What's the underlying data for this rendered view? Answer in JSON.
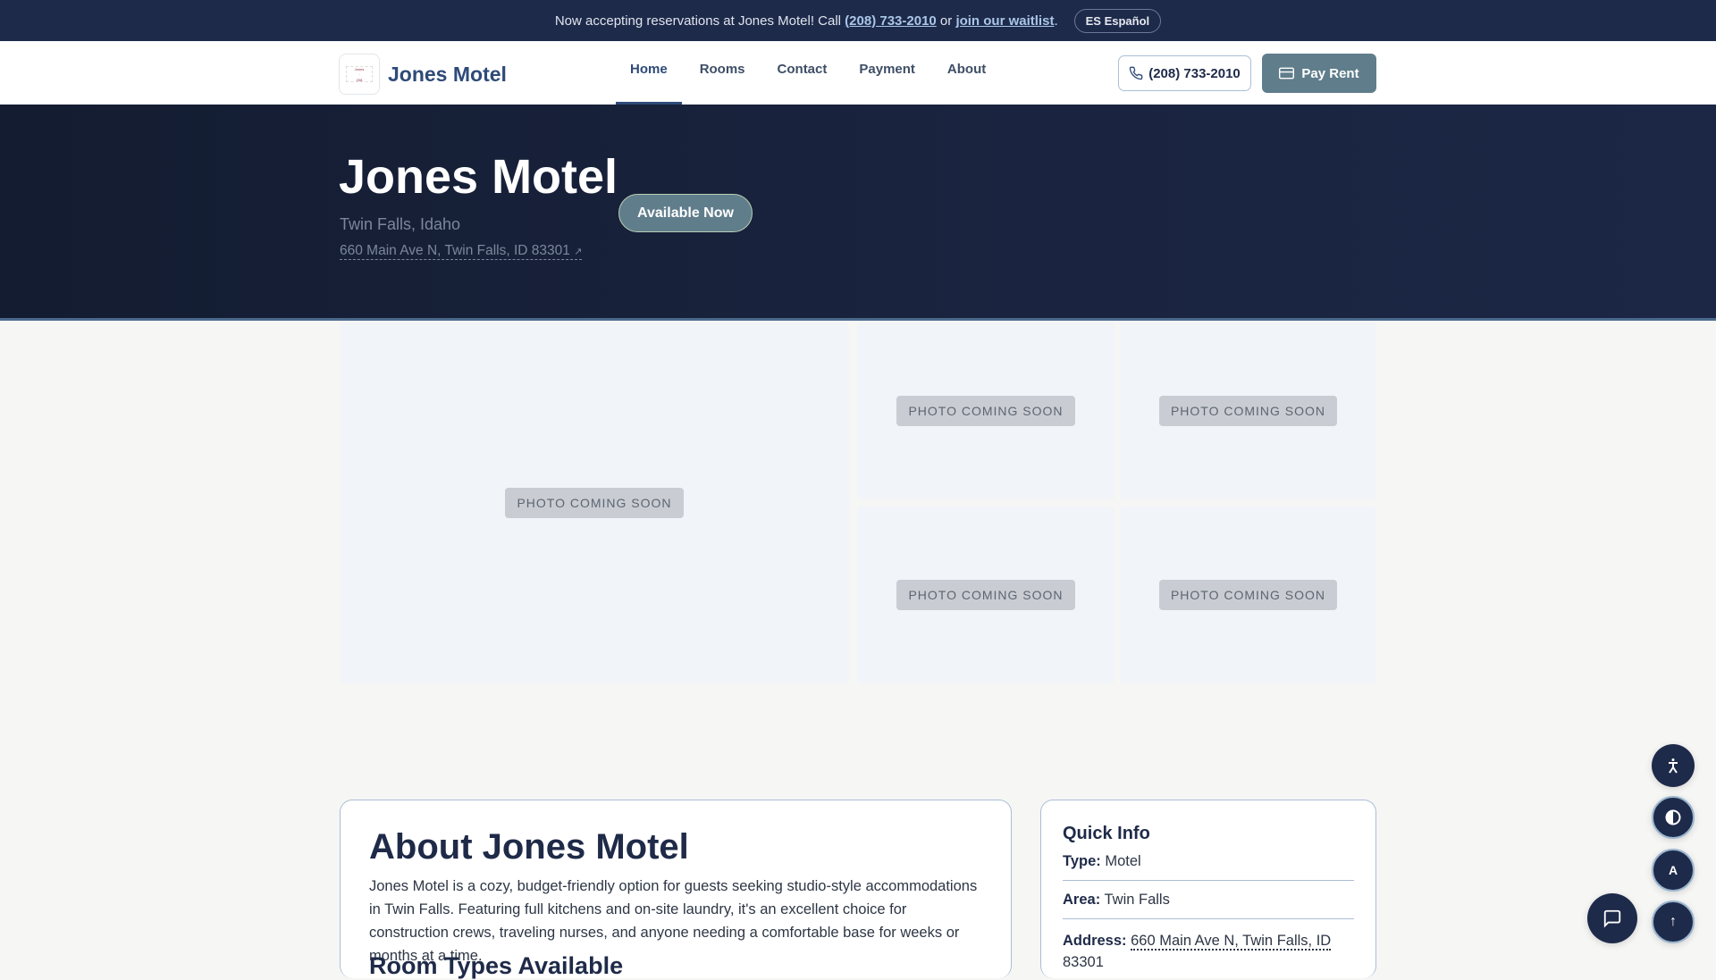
{
  "announcement": {
    "text_before": "Now accepting reservations at Jones Motel! Call ",
    "phone": "(208) 733-2010",
    "text_mid": " or ",
    "waitlist": "join our waitlist",
    "text_after": ".",
    "lang_button": "ES Español"
  },
  "nav": {
    "logo_text": "Jones Motel",
    "logo_phone": "208.733.2010",
    "brand": "Jones Motel",
    "links": [
      "Home",
      "Rooms",
      "Contact",
      "Payment",
      "About"
    ],
    "phone_button": "(208) 733-2010",
    "pay_button": "Pay Rent"
  },
  "hero": {
    "title": "Jones Motel",
    "city": "Twin Falls, Idaho",
    "address": "660 Main Ave N, Twin Falls, ID 83301",
    "address_icon": "↗",
    "badge": "Available Now"
  },
  "gallery": {
    "placeholder": "PHOTO COMING SOON"
  },
  "about": {
    "title": "About Jones Motel",
    "body": "Jones Motel is a cozy, budget-friendly option for guests seeking studio-style accommodations in Twin Falls. Featuring full kitchens and on-site laundry, it's an excellent choice for construction crews, traveling nurses, and anyone needing a comfortable base for weeks or months at a time.",
    "subtitle": "Room Types Available"
  },
  "quick_info": {
    "title": "Quick Info",
    "type_label": "Type:",
    "type_value": "Motel",
    "area_label": "Area:",
    "area_value": "Twin Falls",
    "address_label": "Address:",
    "address_value": "660 Main Ave N, Twin Falls, ID",
    "address_zip": "83301"
  },
  "fabs": {
    "font_label": "A",
    "top_label": "↑"
  }
}
